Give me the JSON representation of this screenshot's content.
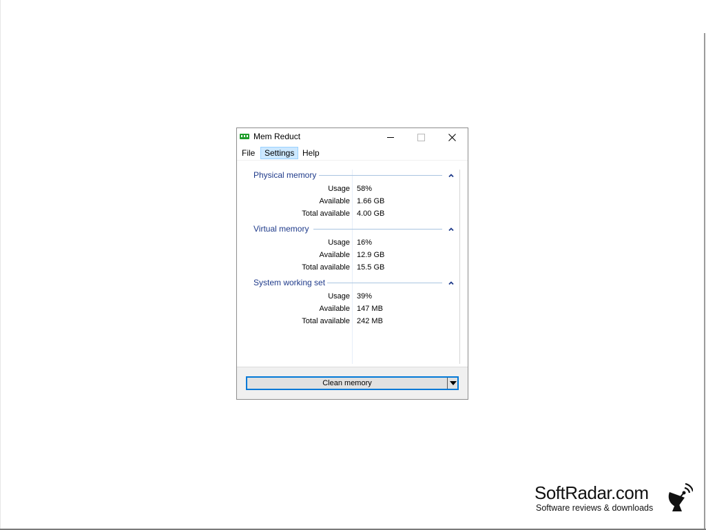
{
  "window": {
    "title": "Mem Reduct",
    "app_icon": "memory-chip-icon",
    "controls": {
      "minimize": "minimize-icon",
      "maximize": "maximize-icon",
      "close": "✕"
    }
  },
  "menu": {
    "file": "File",
    "settings": "Settings",
    "help": "Help"
  },
  "groups": [
    {
      "title": "Physical memory",
      "rows": [
        {
          "label": "Usage",
          "value": "58%"
        },
        {
          "label": "Available",
          "value": "1.66 GB"
        },
        {
          "label": "Total available",
          "value": "4.00 GB"
        }
      ]
    },
    {
      "title": "Virtual memory",
      "rows": [
        {
          "label": "Usage",
          "value": "16%"
        },
        {
          "label": "Available",
          "value": "12.9 GB"
        },
        {
          "label": "Total available",
          "value": "15.5 GB"
        }
      ]
    },
    {
      "title": "System working set",
      "rows": [
        {
          "label": "Usage",
          "value": "39%"
        },
        {
          "label": "Available",
          "value": "147 MB"
        },
        {
          "label": "Total available",
          "value": "242 MB"
        }
      ]
    }
  ],
  "footer": {
    "clean_button": "Clean memory"
  },
  "watermark": {
    "title": "SoftRadar.com",
    "subtitle": "Software reviews & downloads"
  },
  "colors": {
    "accent": "#0078d7",
    "group_header": "#1e3a8a",
    "menu_highlight": "#cce8ff",
    "app_icon": "#1f9d2b"
  }
}
